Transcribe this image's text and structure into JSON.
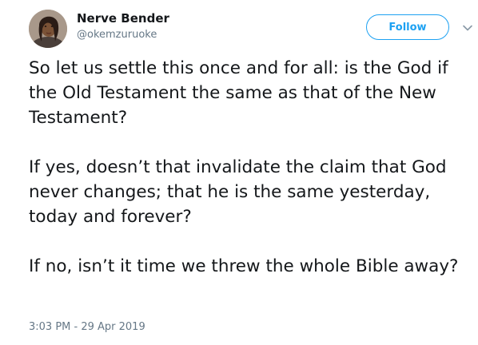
{
  "author": {
    "display_name": "Nerve Bender",
    "handle": "@okemzuruoke",
    "avatar_icon": "profile-photo"
  },
  "follow_label": "Follow",
  "colors": {
    "accent": "#1da1f2",
    "text": "#14171a",
    "muted": "#657786"
  },
  "tweet": {
    "paragraphs": [
      "So let us settle this once and for all: is the God if the Old Testament the same as that of the New Testament?",
      "If yes, doesn’t that invalidate the claim that God never changes; that he is the same yesterday, today and forever?",
      "If no, isn’t it time we threw the whole Bible away?"
    ],
    "timestamp": "3:03 PM - 29 Apr 2019"
  }
}
